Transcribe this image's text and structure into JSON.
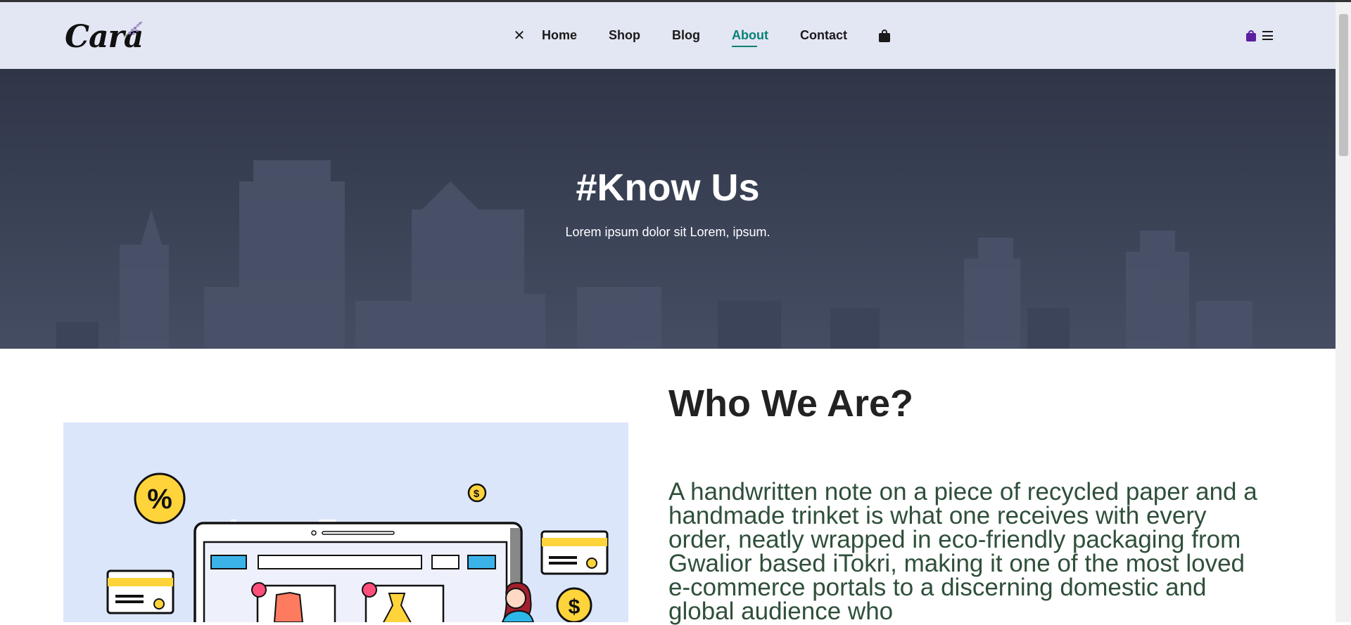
{
  "nav": {
    "logo": "Cara",
    "links": [
      "Home",
      "Shop",
      "Blog",
      "About",
      "Contact"
    ],
    "active": "About",
    "icons": [
      "close-icon",
      "bag-icon",
      "mobile-bag-icon",
      "hamburger-icon"
    ],
    "accent_color": "#088178"
  },
  "hero": {
    "title": "#Know Us",
    "subtitle": "Lorem ipsum dolor sit Lorem, ipsum."
  },
  "about": {
    "title": "Who We Are?",
    "text": "A handwritten note on a piece of recycled paper and a handmade trinket is what one receives with every order, neatly wrapped in eco-friendly packaging from Gwalior based iTokri, making it one of the most loved e-commerce portals to a discerning domestic and global audience who"
  }
}
